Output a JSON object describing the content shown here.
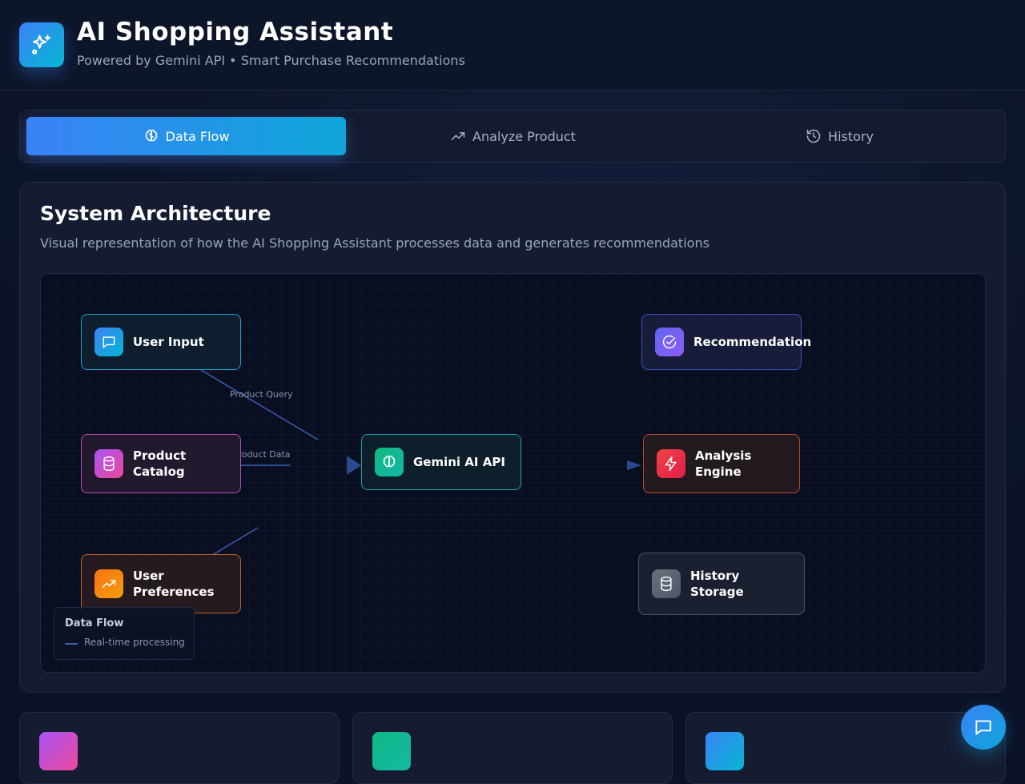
{
  "header": {
    "title": "AI Shopping Assistant",
    "subtitle": "Powered by Gemini API • Smart Purchase Recommendations"
  },
  "tabs": [
    {
      "label": "Data Flow",
      "icon": "brain-icon",
      "active": true
    },
    {
      "label": "Analyze Product",
      "icon": "trending-up-icon",
      "active": false
    },
    {
      "label": "History",
      "icon": "history-icon",
      "active": false
    }
  ],
  "architecture": {
    "title": "System Architecture",
    "subtitle": "Visual representation of how the AI Shopping Assistant processes data and generates recommendations",
    "nodes": {
      "user_input": "User Input",
      "product_catalog": "Product Catalog",
      "user_preferences": "User Preferences",
      "gemini_api": "Gemini AI API",
      "recommendation": "Recommendation",
      "analysis_engine": "Analysis Engine",
      "history_storage": "History Storage"
    },
    "edge_labels": {
      "product_query": "Product Query",
      "product_data": "Product Data"
    },
    "legend": {
      "title": "Data Flow",
      "item": "Real-time processing"
    }
  },
  "colors": {
    "accent": "#3b82f6",
    "accent_cyan": "#0ea5d9",
    "background": "#0c1326"
  }
}
